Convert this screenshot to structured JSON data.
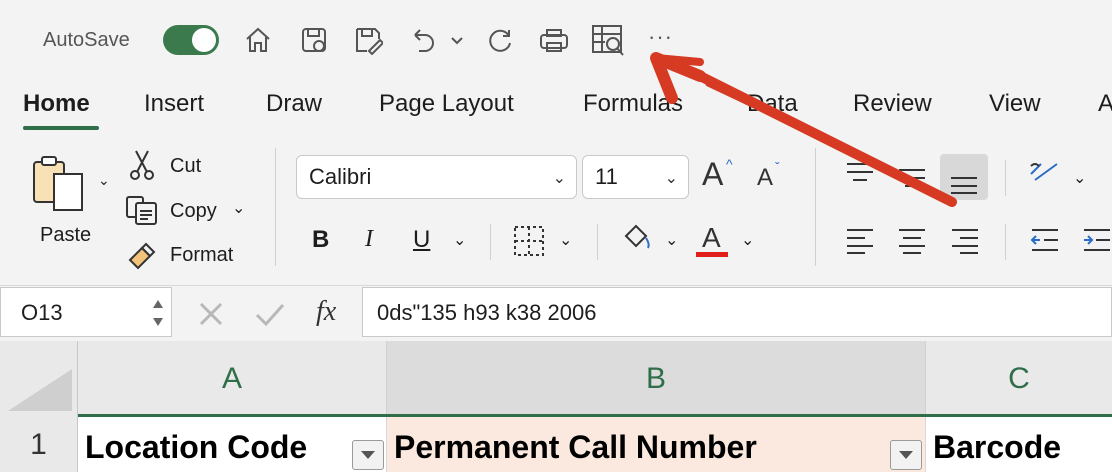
{
  "titlebar": {
    "autosave_label": "AutoSave",
    "qat_icons": [
      "home-icon",
      "save-icon",
      "save-as-icon",
      "undo-icon",
      "undo-dropdown-icon",
      "redo-icon",
      "print-icon",
      "print-preview-icon",
      "more-icon"
    ],
    "more_label": "···"
  },
  "tabs": [
    "Home",
    "Insert",
    "Draw",
    "Page Layout",
    "Formulas",
    "Data",
    "Review",
    "View",
    "A"
  ],
  "ribbon": {
    "paste_label": "Paste",
    "cut_label": "Cut",
    "copy_label": "Copy",
    "format_label": "Format",
    "font_name": "Calibri",
    "font_size": "11",
    "increase_font": "A",
    "decrease_font": "A",
    "bold": "B",
    "italic": "I",
    "underline": "U",
    "font_color": "A",
    "font_color_value": "#e0201c"
  },
  "formula_bar": {
    "cell_ref": "O13",
    "fx_label": "fx",
    "formula_value": "0ds\"135 h93 k38 2006"
  },
  "grid": {
    "columns": [
      "A",
      "B",
      "C"
    ],
    "rows": [
      "1"
    ],
    "cells": [
      "Location Code",
      "Permanent Call Number",
      "Barcode"
    ],
    "selected_column": "B",
    "selected_fill": "#fbe9df",
    "accent": "#2f6e48"
  },
  "annotation": {
    "color": "#d63a22"
  }
}
